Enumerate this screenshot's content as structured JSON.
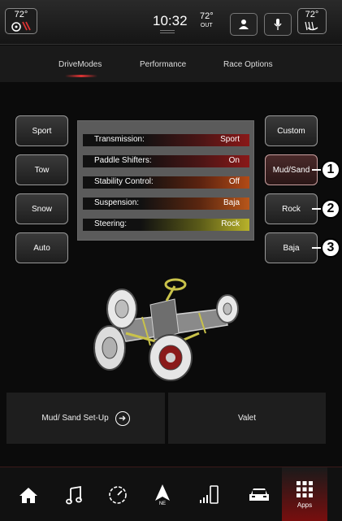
{
  "status_bar": {
    "left_temp": "72°",
    "clock": "10:32",
    "outside_temp": "72°",
    "outside_label": "OUT",
    "right_temp": "72°",
    "icons": [
      "heated-seat-icon",
      "user-icon",
      "microphone-icon",
      "heated-steering-icon"
    ]
  },
  "tabs": [
    {
      "label": "DriveModes",
      "active": true
    },
    {
      "label": "Performance",
      "active": false
    },
    {
      "label": "Race Options",
      "active": false
    }
  ],
  "modes_left": [
    "Sport",
    "Tow",
    "Snow",
    "Auto"
  ],
  "modes_right": [
    {
      "label": "Custom",
      "selected": false
    },
    {
      "label": "Mud/Sand",
      "selected": true
    },
    {
      "label": "Rock",
      "selected": false
    },
    {
      "label": "Baja",
      "selected": false
    }
  ],
  "settings": [
    {
      "label": "Transmission:",
      "value": "Sport"
    },
    {
      "label": "Paddle Shifters:",
      "value": "On"
    },
    {
      "label": "Stability Control:",
      "value": "Off"
    },
    {
      "label": "Suspension:",
      "value": "Baja"
    },
    {
      "label": "Steering:",
      "value": "Rock"
    }
  ],
  "callouts": [
    "1",
    "2",
    "3"
  ],
  "actions": {
    "setup_label": "Mud/ Sand Set-Up",
    "valet_label": "Valet"
  },
  "nav": {
    "items": [
      "home-icon",
      "music-icon",
      "performance-icon",
      "navigation-icon",
      "phone-icon",
      "vehicle-icon"
    ],
    "nav_sub": "NE",
    "apps_label": "Apps"
  },
  "colors": {
    "accent_red": "#c81e1e",
    "steering_yellow": "#b8b22a",
    "suspension_orange": "#b8561a"
  }
}
